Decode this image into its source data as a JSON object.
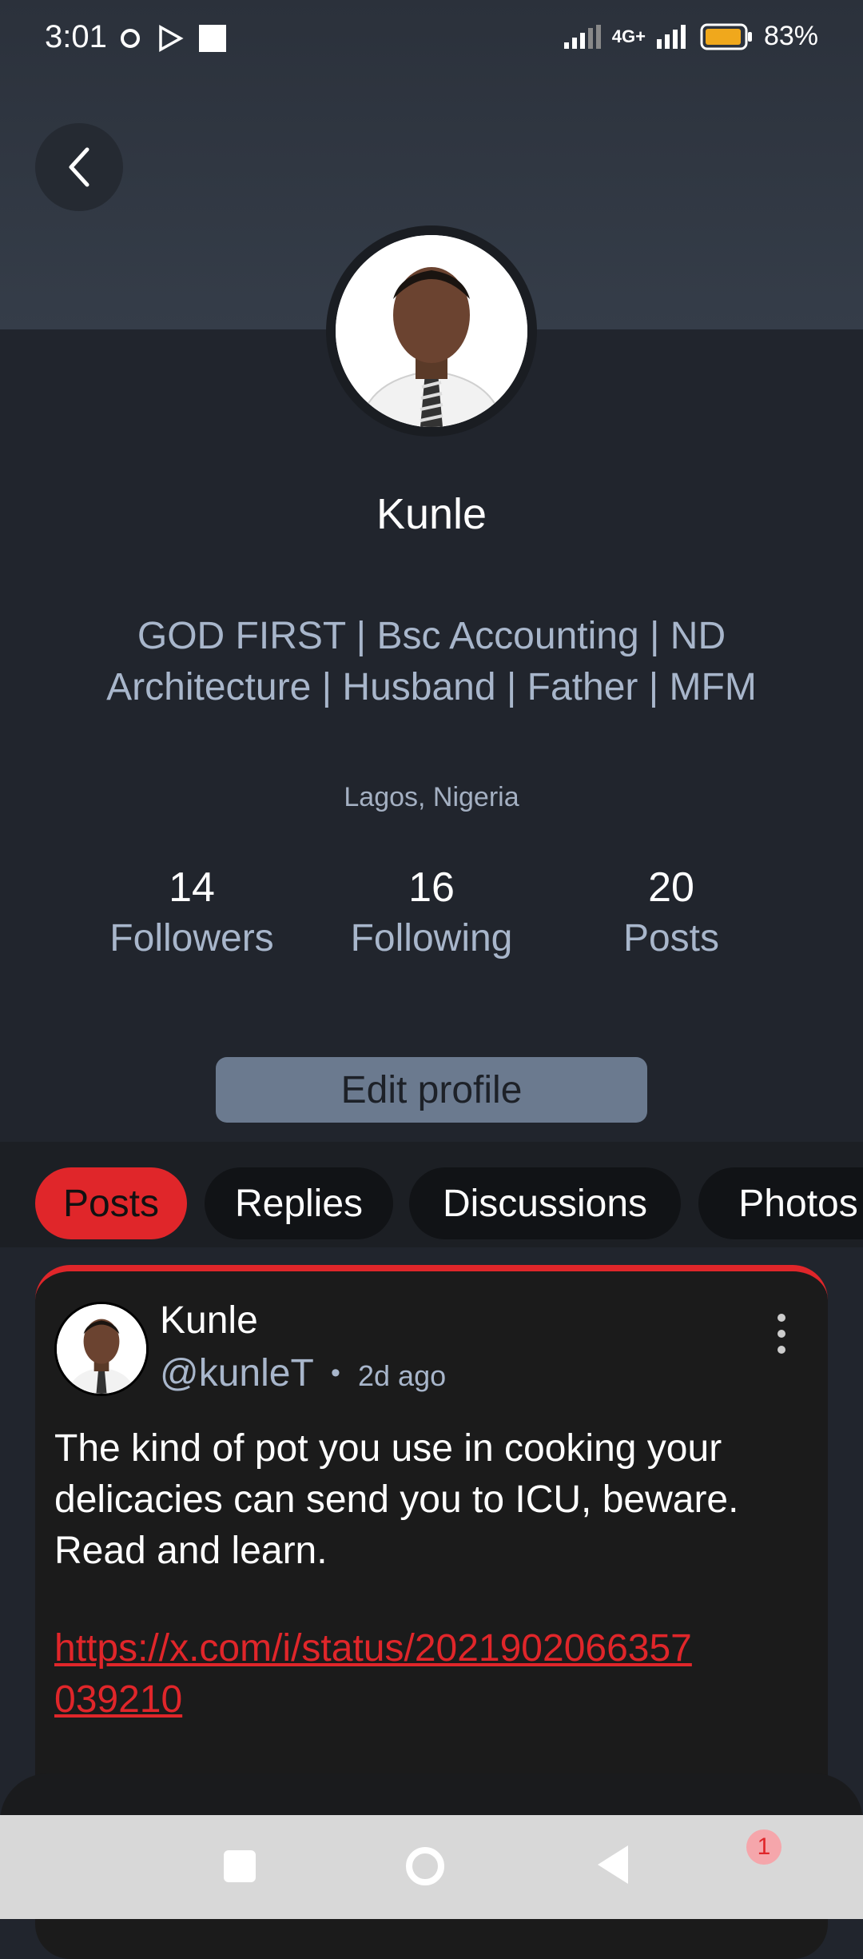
{
  "status_bar": {
    "time": "3:01",
    "network": "4G+",
    "battery": "83%"
  },
  "profile": {
    "name": "Kunle",
    "bio": "GOD FIRST | Bsc Accounting | ND Architecture | Husband | Father | MFM",
    "location": "Lagos, Nigeria",
    "stats": [
      {
        "value": "14",
        "label": "Followers"
      },
      {
        "value": "16",
        "label": "Following"
      },
      {
        "value": "20",
        "label": "Posts"
      }
    ],
    "edit_label": "Edit profile"
  },
  "tabs": [
    {
      "label": "Posts",
      "active": true
    },
    {
      "label": "Replies",
      "active": false
    },
    {
      "label": "Discussions",
      "active": false
    },
    {
      "label": "Photos",
      "active": false
    }
  ],
  "post": {
    "author": "Kunle",
    "handle": "@kunleT",
    "separator": "•",
    "time": "2d ago",
    "text": "The kind of pot you use in cooking your delicacies can send you to ICU, beware. Read and learn.",
    "link": "https://x.com/i/status/2021902066357039210"
  },
  "nav": {
    "badge": "1"
  },
  "colors": {
    "accent": "#e0262a",
    "muted_text": "#a8b6cb",
    "background": "#21252d"
  }
}
